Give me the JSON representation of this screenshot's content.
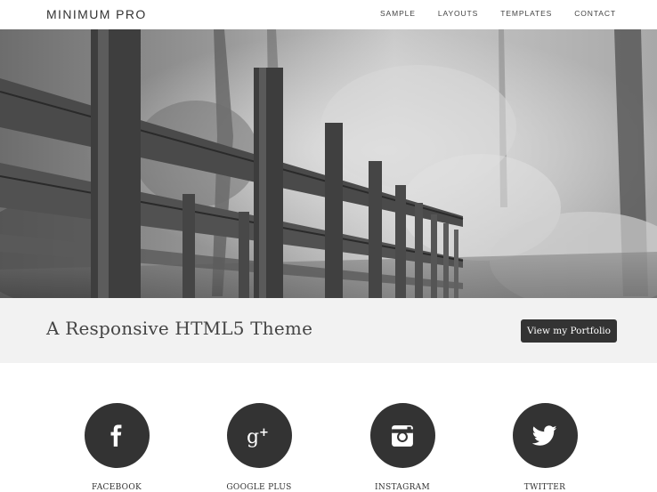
{
  "header": {
    "site_title": "MINIMUM PRO",
    "nav": [
      "SAMPLE",
      "LAYOUTS",
      "TEMPLATES",
      "CONTACT"
    ]
  },
  "hero": {
    "image_desc": "black-and-white-wooden-boardwalk-in-forest"
  },
  "tagline_band": {
    "tagline": "A Responsive HTML5 Theme",
    "button_label": "View my Portfolio"
  },
  "social": [
    {
      "label": "FACEBOOK",
      "icon": "facebook-icon"
    },
    {
      "label": "GOOGLE PLUS",
      "icon": "google-plus-icon"
    },
    {
      "label": "INSTAGRAM",
      "icon": "instagram-icon"
    },
    {
      "label": "TWITTER",
      "icon": "twitter-icon"
    }
  ],
  "colors": {
    "dark": "#333333",
    "band": "#f2f2f2"
  }
}
